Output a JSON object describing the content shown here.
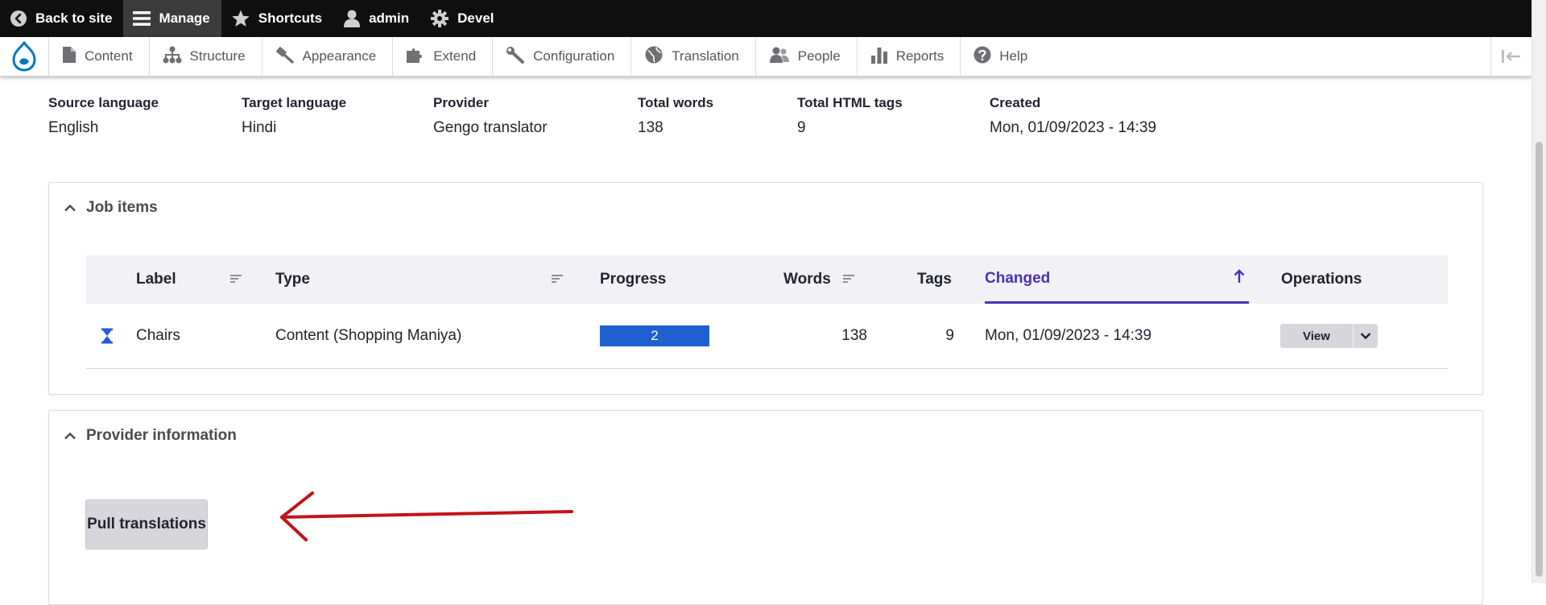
{
  "toolbar": {
    "back": "Back to site",
    "manage": "Manage",
    "shortcuts": "Shortcuts",
    "user": "admin",
    "devel": "Devel"
  },
  "tray": {
    "items": [
      "Content",
      "Structure",
      "Appearance",
      "Extend",
      "Configuration",
      "Translation",
      "People",
      "Reports",
      "Help"
    ]
  },
  "summary": [
    {
      "label": "Source language",
      "value": "English"
    },
    {
      "label": "Target language",
      "value": "Hindi"
    },
    {
      "label": "Provider",
      "value": "Gengo translator"
    },
    {
      "label": "Total words",
      "value": "138"
    },
    {
      "label": "Total HTML tags",
      "value": "9"
    },
    {
      "label": "Created",
      "value": "Mon, 01/09/2023 - 14:39"
    }
  ],
  "job_items": {
    "title": "Job items",
    "columns": {
      "label": "Label",
      "type": "Type",
      "progress": "Progress",
      "words": "Words",
      "tags": "Tags",
      "changed": "Changed",
      "operations": "Operations"
    },
    "row": {
      "label": "Chairs",
      "type": "Content (Shopping Maniya)",
      "progress": "2",
      "words": "138",
      "tags": "9",
      "changed": "Mon, 01/09/2023 - 14:39",
      "op_label": "View"
    }
  },
  "provider": {
    "title": "Provider information",
    "pull_label": "Pull translations"
  },
  "colors": {
    "accent": "#4a2fbd",
    "progress": "#1f5fcf",
    "annotation_arrow": "#c0141c",
    "drupal_blue": "#0678be"
  }
}
